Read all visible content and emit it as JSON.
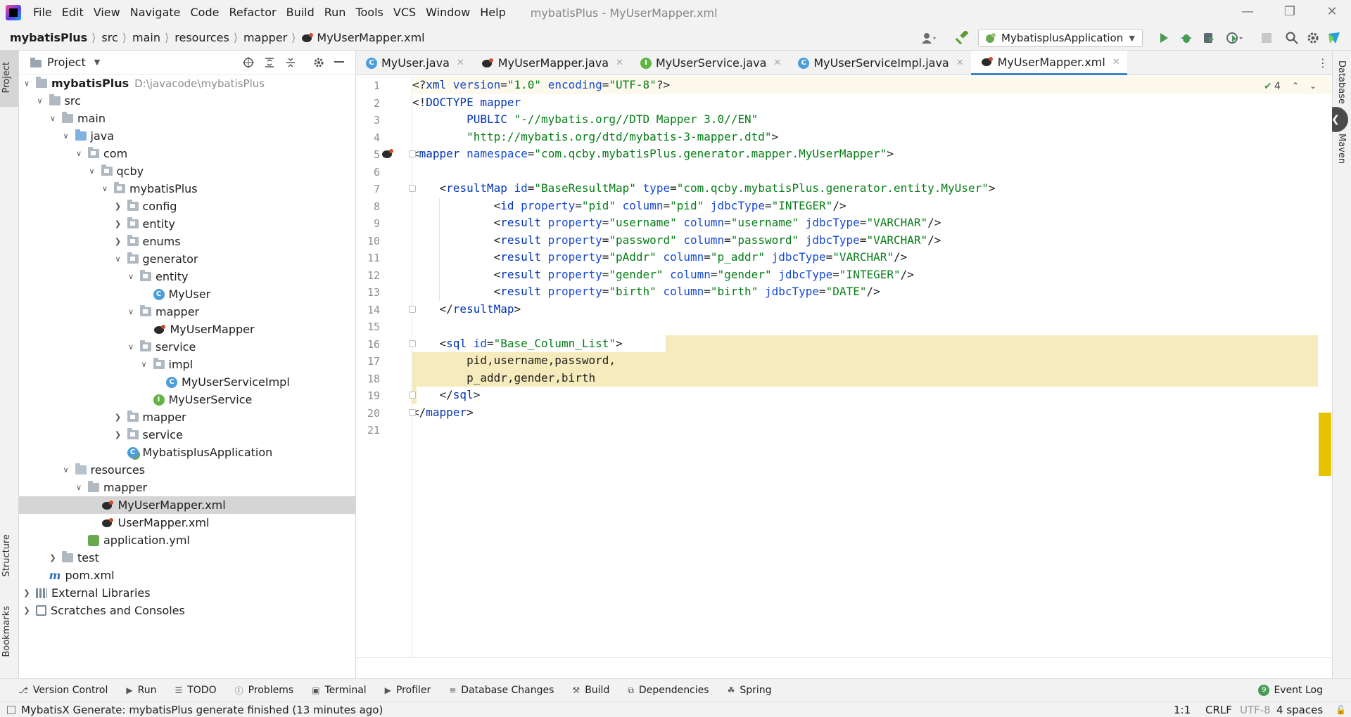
{
  "menubar": {
    "items": [
      "File",
      "Edit",
      "View",
      "Navigate",
      "Code",
      "Refactor",
      "Build",
      "Run",
      "Tools",
      "VCS",
      "Window",
      "Help"
    ],
    "window_title": "mybatisPlus - MyUserMapper.xml"
  },
  "breadcrumb": [
    "mybatisPlus",
    "src",
    "main",
    "resources",
    "mapper",
    "MyUserMapper.xml"
  ],
  "run_config": "MybatisplusApplication",
  "left_stripe": {
    "project": "Project",
    "structure": "Structure",
    "bookmarks": "Bookmarks"
  },
  "right_stripe": {
    "database": "Database",
    "maven": "Maven"
  },
  "project_panel": {
    "title": "Project",
    "tree": [
      {
        "label": "mybatisPlus",
        "path": "D:\\javacode\\mybatisPlus",
        "depth": 0,
        "arrow": "open",
        "icon": "folder",
        "bold": true
      },
      {
        "label": "src",
        "depth": 1,
        "arrow": "open",
        "icon": "folder"
      },
      {
        "label": "main",
        "depth": 2,
        "arrow": "open",
        "icon": "folder"
      },
      {
        "label": "java",
        "depth": 3,
        "arrow": "open",
        "icon": "folder-blue"
      },
      {
        "label": "com",
        "depth": 4,
        "arrow": "open",
        "icon": "package"
      },
      {
        "label": "qcby",
        "depth": 5,
        "arrow": "open",
        "icon": "package"
      },
      {
        "label": "mybatisPlus",
        "depth": 6,
        "arrow": "open",
        "icon": "package"
      },
      {
        "label": "config",
        "depth": 7,
        "arrow": "closed",
        "icon": "package"
      },
      {
        "label": "entity",
        "depth": 7,
        "arrow": "closed",
        "icon": "package"
      },
      {
        "label": "enums",
        "depth": 7,
        "arrow": "closed",
        "icon": "package"
      },
      {
        "label": "generator",
        "depth": 7,
        "arrow": "open",
        "icon": "package"
      },
      {
        "label": "entity",
        "depth": 8,
        "arrow": "open",
        "icon": "package"
      },
      {
        "label": "MyUser",
        "depth": 9,
        "arrow": "none",
        "icon": "class"
      },
      {
        "label": "mapper",
        "depth": 8,
        "arrow": "open",
        "icon": "package"
      },
      {
        "label": "MyUserMapper",
        "depth": 9,
        "arrow": "none",
        "icon": "mapper"
      },
      {
        "label": "service",
        "depth": 8,
        "arrow": "open",
        "icon": "package"
      },
      {
        "label": "impl",
        "depth": 9,
        "arrow": "open",
        "icon": "package"
      },
      {
        "label": "MyUserServiceImpl",
        "depth": 10,
        "arrow": "none",
        "icon": "class"
      },
      {
        "label": "MyUserService",
        "depth": 9,
        "arrow": "none",
        "icon": "interface"
      },
      {
        "label": "mapper",
        "depth": 7,
        "arrow": "closed",
        "icon": "package"
      },
      {
        "label": "service",
        "depth": 7,
        "arrow": "closed",
        "icon": "package"
      },
      {
        "label": "MybatisplusApplication",
        "depth": 7,
        "arrow": "none",
        "icon": "spring-class"
      },
      {
        "label": "resources",
        "depth": 3,
        "arrow": "open",
        "icon": "folder-res"
      },
      {
        "label": "mapper",
        "depth": 4,
        "arrow": "open",
        "icon": "folder"
      },
      {
        "label": "MyUserMapper.xml",
        "depth": 5,
        "arrow": "none",
        "icon": "mapper",
        "selected": true
      },
      {
        "label": "UserMapper.xml",
        "depth": 5,
        "arrow": "none",
        "icon": "mapper"
      },
      {
        "label": "application.yml",
        "depth": 4,
        "arrow": "none",
        "icon": "yml"
      },
      {
        "label": "test",
        "depth": 2,
        "arrow": "closed",
        "icon": "folder"
      },
      {
        "label": "pom.xml",
        "depth": 1,
        "arrow": "none",
        "icon": "maven"
      },
      {
        "label": "External Libraries",
        "depth": 0,
        "arrow": "closed",
        "icon": "libraries"
      },
      {
        "label": "Scratches and Consoles",
        "depth": 0,
        "arrow": "closed",
        "icon": "scratches"
      }
    ]
  },
  "tabs": [
    {
      "label": "MyUser.java",
      "icon": "class",
      "active": false
    },
    {
      "label": "MyUserMapper.java",
      "icon": "mapper",
      "active": false
    },
    {
      "label": "MyUserService.java",
      "icon": "interface",
      "active": false
    },
    {
      "label": "MyUserServiceImpl.java",
      "icon": "class",
      "active": false
    },
    {
      "label": "MyUserMapper.xml",
      "icon": "mapper",
      "active": true
    }
  ],
  "editor": {
    "inspections_count": "4",
    "lines": [
      [
        [
          "p",
          "<?"
        ],
        [
          "t",
          "xml "
        ],
        [
          "a",
          "version"
        ],
        [
          "p",
          "="
        ],
        [
          "v",
          "\"1.0\""
        ],
        [
          "p",
          " "
        ],
        [
          "a",
          "encoding"
        ],
        [
          "p",
          "="
        ],
        [
          "v",
          "\"UTF-8\""
        ],
        [
          "p",
          "?>"
        ]
      ],
      [
        [
          "p",
          "<!"
        ],
        [
          "t",
          "DOCTYPE mapper"
        ]
      ],
      [
        [
          "p",
          "        "
        ],
        [
          "t",
          "PUBLIC "
        ],
        [
          "v",
          "\"-//mybatis.org//DTD Mapper 3.0//EN\""
        ]
      ],
      [
        [
          "p",
          "        "
        ],
        [
          "v",
          "\"http://mybatis.org/dtd/mybatis-3-mapper.dtd\""
        ],
        [
          "p",
          ">"
        ]
      ],
      [
        [
          "p",
          "<"
        ],
        [
          "t",
          "mapper "
        ],
        [
          "a",
          "namespace"
        ],
        [
          "p",
          "="
        ],
        [
          "v",
          "\"com.qcby.mybatisPlus.generator.mapper.MyUserMapper\""
        ],
        [
          "p",
          ">"
        ]
      ],
      [],
      [
        [
          "p",
          "    <"
        ],
        [
          "t",
          "resultMap "
        ],
        [
          "a",
          "id"
        ],
        [
          "p",
          "="
        ],
        [
          "v",
          "\"BaseResultMap\""
        ],
        [
          "p",
          " "
        ],
        [
          "a",
          "type"
        ],
        [
          "p",
          "="
        ],
        [
          "v",
          "\"com.qcby.mybatisPlus.generator.entity.MyUser\""
        ],
        [
          "p",
          ">"
        ]
      ],
      [
        [
          "p",
          "            <"
        ],
        [
          "t",
          "id "
        ],
        [
          "a",
          "property"
        ],
        [
          "p",
          "="
        ],
        [
          "v",
          "\"pid\""
        ],
        [
          "p",
          " "
        ],
        [
          "a",
          "column"
        ],
        [
          "p",
          "="
        ],
        [
          "v",
          "\"pid\""
        ],
        [
          "p",
          " "
        ],
        [
          "a",
          "jdbcType"
        ],
        [
          "p",
          "="
        ],
        [
          "v",
          "\"INTEGER\""
        ],
        [
          "p",
          "/>"
        ]
      ],
      [
        [
          "p",
          "            <"
        ],
        [
          "t",
          "result "
        ],
        [
          "a",
          "property"
        ],
        [
          "p",
          "="
        ],
        [
          "v",
          "\"username\""
        ],
        [
          "p",
          " "
        ],
        [
          "a",
          "column"
        ],
        [
          "p",
          "="
        ],
        [
          "v",
          "\"username\""
        ],
        [
          "p",
          " "
        ],
        [
          "a",
          "jdbcType"
        ],
        [
          "p",
          "="
        ],
        [
          "v",
          "\"VARCHAR\""
        ],
        [
          "p",
          "/>"
        ]
      ],
      [
        [
          "p",
          "            <"
        ],
        [
          "t",
          "result "
        ],
        [
          "a",
          "property"
        ],
        [
          "p",
          "="
        ],
        [
          "v",
          "\"password\""
        ],
        [
          "p",
          " "
        ],
        [
          "a",
          "column"
        ],
        [
          "p",
          "="
        ],
        [
          "v",
          "\"password\""
        ],
        [
          "p",
          " "
        ],
        [
          "a",
          "jdbcType"
        ],
        [
          "p",
          "="
        ],
        [
          "v",
          "\"VARCHAR\""
        ],
        [
          "p",
          "/>"
        ]
      ],
      [
        [
          "p",
          "            <"
        ],
        [
          "t",
          "result "
        ],
        [
          "a",
          "property"
        ],
        [
          "p",
          "="
        ],
        [
          "v",
          "\"pAddr\""
        ],
        [
          "p",
          " "
        ],
        [
          "a",
          "column"
        ],
        [
          "p",
          "="
        ],
        [
          "v",
          "\"p_addr\""
        ],
        [
          "p",
          " "
        ],
        [
          "a",
          "jdbcType"
        ],
        [
          "p",
          "="
        ],
        [
          "v",
          "\"VARCHAR\""
        ],
        [
          "p",
          "/>"
        ]
      ],
      [
        [
          "p",
          "            <"
        ],
        [
          "t",
          "result "
        ],
        [
          "a",
          "property"
        ],
        [
          "p",
          "="
        ],
        [
          "v",
          "\"gender\""
        ],
        [
          "p",
          " "
        ],
        [
          "a",
          "column"
        ],
        [
          "p",
          "="
        ],
        [
          "v",
          "\"gender\""
        ],
        [
          "p",
          " "
        ],
        [
          "a",
          "jdbcType"
        ],
        [
          "p",
          "="
        ],
        [
          "v",
          "\"INTEGER\""
        ],
        [
          "p",
          "/>"
        ]
      ],
      [
        [
          "p",
          "            <"
        ],
        [
          "t",
          "result "
        ],
        [
          "a",
          "property"
        ],
        [
          "p",
          "="
        ],
        [
          "v",
          "\"birth\""
        ],
        [
          "p",
          " "
        ],
        [
          "a",
          "column"
        ],
        [
          "p",
          "="
        ],
        [
          "v",
          "\"birth\""
        ],
        [
          "p",
          " "
        ],
        [
          "a",
          "jdbcType"
        ],
        [
          "p",
          "="
        ],
        [
          "v",
          "\"DATE\""
        ],
        [
          "p",
          "/>"
        ]
      ],
      [
        [
          "p",
          "    </"
        ],
        [
          "t",
          "resultMap"
        ],
        [
          "p",
          ">"
        ]
      ],
      [],
      [
        [
          "p",
          "    <"
        ],
        [
          "t",
          "sql "
        ],
        [
          "a",
          "id"
        ],
        [
          "p",
          "="
        ],
        [
          "v",
          "\"Base_Column_List\""
        ],
        [
          "p",
          ">"
        ]
      ],
      [
        [
          "p",
          "        pid,username,password,"
        ]
      ],
      [
        [
          "p",
          "        p_addr,gender,birth"
        ]
      ],
      [
        [
          "p",
          "    </"
        ],
        [
          "t",
          "sql"
        ],
        [
          "p",
          ">"
        ]
      ],
      [
        [
          "p",
          "</"
        ],
        [
          "t",
          "mapper"
        ],
        [
          "p",
          ">"
        ]
      ],
      []
    ]
  },
  "bottom_tools": [
    "Version Control",
    "Run",
    "TODO",
    "Problems",
    "Terminal",
    "Profiler",
    "Database Changes",
    "Build",
    "Dependencies",
    "Spring"
  ],
  "event_log": "Event Log",
  "status": {
    "message": "MybatisX Generate: mybatisPlus generate finished (13 minutes ago)",
    "position": "1:1",
    "line_sep": "CRLF",
    "encoding": "UTF-8",
    "indent": "4 spaces"
  }
}
